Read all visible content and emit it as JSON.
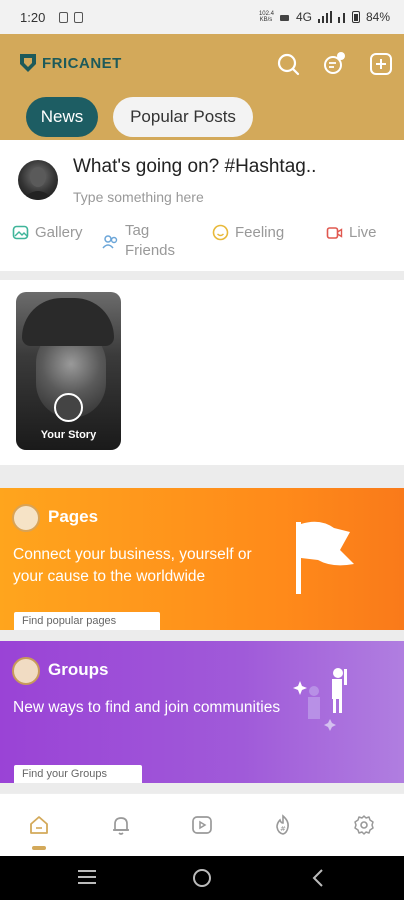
{
  "status_bar": {
    "time": "1:20",
    "network": "4G",
    "speed": "102.4 KB/s",
    "battery": "84%"
  },
  "app": {
    "name": "FRICANET"
  },
  "header": {
    "tabs": [
      {
        "label": "News",
        "active": true
      },
      {
        "label": "Popular Posts",
        "active": false
      }
    ],
    "icons": [
      "search-icon",
      "chat-icon",
      "add-post-icon"
    ]
  },
  "composer": {
    "prompt": "What's going on? #Hashtag..",
    "placeholder": "Type something here",
    "actions": [
      {
        "label": "Gallery",
        "icon": "gallery-icon",
        "color": "#3fb59a"
      },
      {
        "label": "Tag Friends",
        "icon": "tag-friends-icon",
        "color": "#6aa5d8"
      },
      {
        "label": "Feeling",
        "icon": "feeling-icon",
        "color": "#e8b93a"
      },
      {
        "label": "Live",
        "icon": "live-icon",
        "color": "#e0584f"
      }
    ]
  },
  "stories": {
    "your_story_label": "Your Story"
  },
  "promos": {
    "pages": {
      "title": "Pages",
      "description": "Connect your business, yourself or your cause to the worldwide",
      "cta": "Find popular pages",
      "color": "#ff9a1c"
    },
    "groups": {
      "title": "Groups",
      "description": "New ways to find and join communities",
      "cta": "Find your Groups",
      "color": "#9b4bd6"
    }
  },
  "bottom_nav": {
    "items": [
      "home-icon",
      "notifications-icon",
      "video-icon",
      "hashtag-icon",
      "settings-icon"
    ],
    "active": "home-icon",
    "accent": "#d3a95a"
  }
}
